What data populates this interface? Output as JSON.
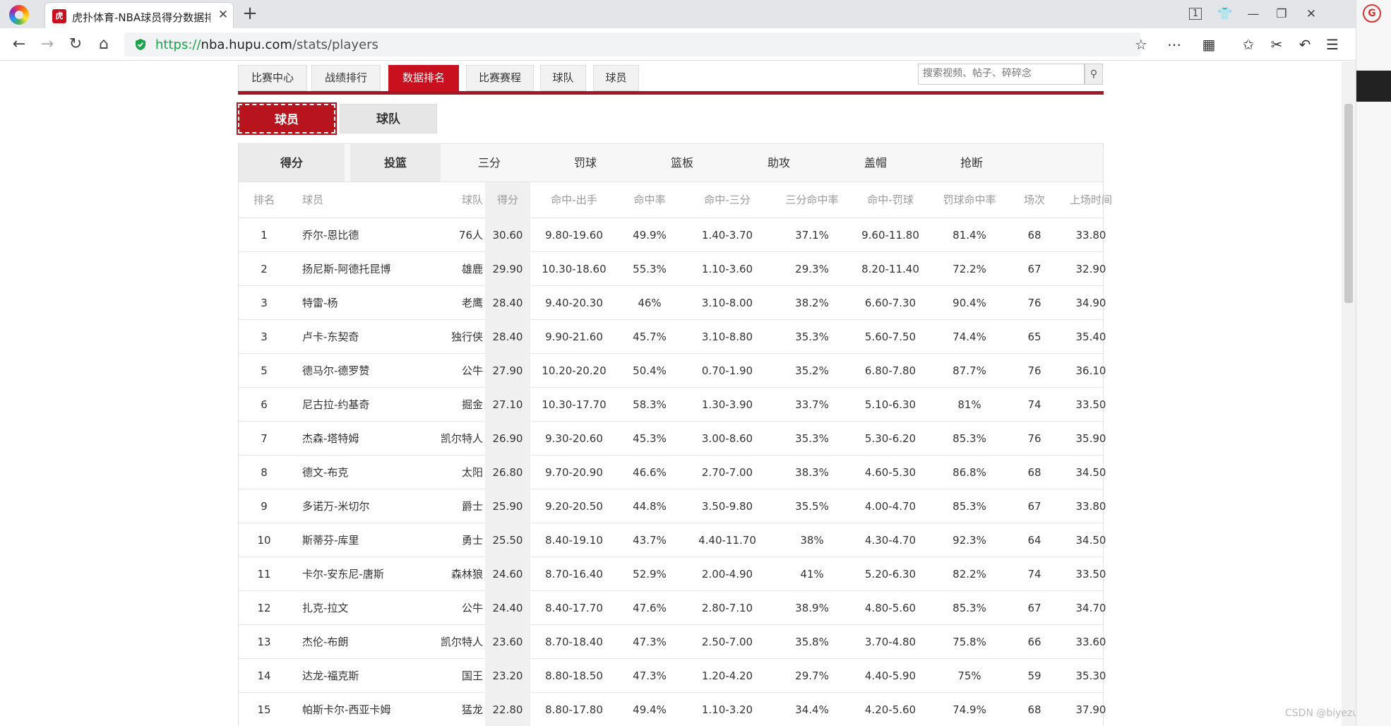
{
  "browser": {
    "tab_title": "虎扑体育-NBA球员得分数据排",
    "favicon_text": "虎扑",
    "tab_close": "✕",
    "new_tab": "+",
    "tab_count": "1",
    "url": {
      "proto": "https://",
      "host": "nba.hupu.com",
      "path": "/stats/players"
    },
    "side_logo": "G",
    "watermark": "CSDN @biyezuopin"
  },
  "site": {
    "nav": [
      "比赛中心",
      "战绩排行",
      "数据排名",
      "比赛赛程",
      "球队",
      "球员"
    ],
    "nav_active": "数据排名",
    "search_placeholder": "搜索视频、帖子、碎碎念",
    "subtabs": [
      "球员",
      "球队"
    ],
    "stat_tabs": [
      "得分",
      "投篮",
      "三分",
      "罚球",
      "篮板",
      "助攻",
      "盖帽",
      "抢断"
    ],
    "brand_color": "#c8101f"
  },
  "table": {
    "headers": [
      "排名",
      "球员",
      "球队",
      "得分",
      "命中-出手",
      "命中率",
      "命中-三分",
      "三分命中率",
      "命中-罚球",
      "罚球命中率",
      "场次",
      "上场时间"
    ],
    "rows": [
      [
        "1",
        "乔尔-恩比德",
        "76人",
        "30.60",
        "9.80-19.60",
        "49.9%",
        "1.40-3.70",
        "37.1%",
        "9.60-11.80",
        "81.4%",
        "68",
        "33.80"
      ],
      [
        "2",
        "扬尼斯-阿德托昆博",
        "雄鹿",
        "29.90",
        "10.30-18.60",
        "55.3%",
        "1.10-3.60",
        "29.3%",
        "8.20-11.40",
        "72.2%",
        "67",
        "32.90"
      ],
      [
        "3",
        "特雷-杨",
        "老鹰",
        "28.40",
        "9.40-20.30",
        "46%",
        "3.10-8.00",
        "38.2%",
        "6.60-7.30",
        "90.4%",
        "76",
        "34.90"
      ],
      [
        "3",
        "卢卡-东契奇",
        "独行侠",
        "28.40",
        "9.90-21.60",
        "45.7%",
        "3.10-8.80",
        "35.3%",
        "5.60-7.50",
        "74.4%",
        "65",
        "35.40"
      ],
      [
        "5",
        "德马尔-德罗赞",
        "公牛",
        "27.90",
        "10.20-20.20",
        "50.4%",
        "0.70-1.90",
        "35.2%",
        "6.80-7.80",
        "87.7%",
        "76",
        "36.10"
      ],
      [
        "6",
        "尼古拉-约基奇",
        "掘金",
        "27.10",
        "10.30-17.70",
        "58.3%",
        "1.30-3.90",
        "33.7%",
        "5.10-6.30",
        "81%",
        "74",
        "33.50"
      ],
      [
        "7",
        "杰森-塔特姆",
        "凯尔特人",
        "26.90",
        "9.30-20.60",
        "45.3%",
        "3.00-8.60",
        "35.3%",
        "5.30-6.20",
        "85.3%",
        "76",
        "35.90"
      ],
      [
        "8",
        "德文-布克",
        "太阳",
        "26.80",
        "9.70-20.90",
        "46.6%",
        "2.70-7.00",
        "38.3%",
        "4.60-5.30",
        "86.8%",
        "68",
        "34.50"
      ],
      [
        "9",
        "多诺万-米切尔",
        "爵士",
        "25.90",
        "9.20-20.50",
        "44.8%",
        "3.50-9.80",
        "35.5%",
        "4.00-4.70",
        "85.3%",
        "67",
        "33.80"
      ],
      [
        "10",
        "斯蒂芬-库里",
        "勇士",
        "25.50",
        "8.40-19.10",
        "43.7%",
        "4.40-11.70",
        "38%",
        "4.30-4.70",
        "92.3%",
        "64",
        "34.50"
      ],
      [
        "11",
        "卡尔-安东尼-唐斯",
        "森林狼",
        "24.60",
        "8.70-16.40",
        "52.9%",
        "2.00-4.90",
        "41%",
        "5.20-6.30",
        "82.2%",
        "74",
        "33.50"
      ],
      [
        "12",
        "扎克-拉文",
        "公牛",
        "24.40",
        "8.40-17.70",
        "47.6%",
        "2.80-7.10",
        "38.9%",
        "4.80-5.60",
        "85.3%",
        "67",
        "34.70"
      ],
      [
        "13",
        "杰伦-布朗",
        "凯尔特人",
        "23.60",
        "8.70-18.40",
        "47.3%",
        "2.50-7.00",
        "35.8%",
        "3.70-4.80",
        "75.8%",
        "66",
        "33.60"
      ],
      [
        "14",
        "达龙-福克斯",
        "国王",
        "23.20",
        "8.80-18.50",
        "47.3%",
        "1.20-4.20",
        "29.7%",
        "4.40-5.90",
        "75%",
        "59",
        "35.30"
      ],
      [
        "15",
        "帕斯卡尔-西亚卡姆",
        "猛龙",
        "22.80",
        "8.80-17.80",
        "49.4%",
        "1.10-3.20",
        "34.4%",
        "4.20-5.60",
        "74.9%",
        "68",
        "37.90"
      ]
    ]
  }
}
